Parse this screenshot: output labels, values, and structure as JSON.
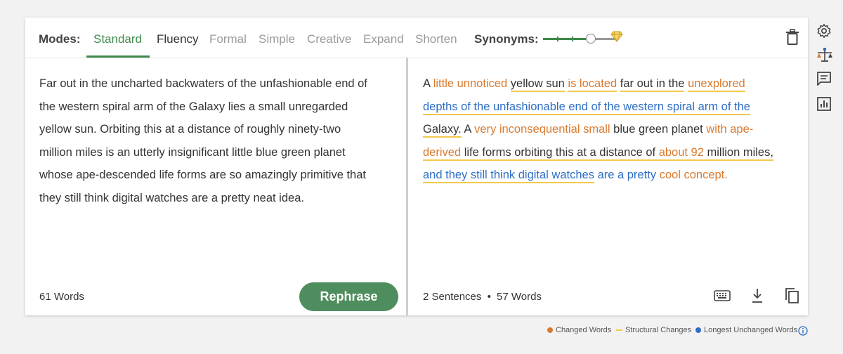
{
  "modes": {
    "label": "Modes:",
    "items": [
      "Standard",
      "Fluency",
      "Formal",
      "Simple",
      "Creative",
      "Expand",
      "Shorten"
    ],
    "active": "Standard"
  },
  "synonyms": {
    "label": "Synonyms:",
    "level": 0.6
  },
  "input": {
    "lines": [
      "Far out in the uncharted backwaters of the unfashionable end of",
      "the western spiral arm of the Galaxy lies a small unregarded",
      "yellow sun. Orbiting this at a distance of roughly ninety-two",
      "million miles is an utterly insignificant little blue green planet",
      "whose ape-descended life forms are so amazingly primitive that",
      "they still think digital watches are a pretty neat idea."
    ],
    "word_count": "61 Words",
    "rephrase_label": "Rephrase"
  },
  "output": {
    "segments": [
      {
        "t": "A ",
        "c": ""
      },
      {
        "t": "little unnoticed",
        "c": "orange"
      },
      {
        "t": " ",
        "c": ""
      },
      {
        "t": "yellow sun",
        "c": "ul"
      },
      {
        "t": " ",
        "c": ""
      },
      {
        "t": "is located",
        "c": "orange ul"
      },
      {
        "t": " ",
        "c": ""
      },
      {
        "t": "far out in the",
        "c": "ul"
      },
      {
        "t": " ",
        "c": ""
      },
      {
        "t": "unexplored",
        "c": "orange ul"
      },
      {
        "br": true
      },
      {
        "t": "depths of the unfashionable end of the western spiral arm of the",
        "c": "blue ul"
      },
      {
        "br": true
      },
      {
        "t": "Galaxy.",
        "c": "ul"
      },
      {
        "t": " A ",
        "c": ""
      },
      {
        "t": "very inconsequential small",
        "c": "orange"
      },
      {
        "t": " blue green planet ",
        "c": ""
      },
      {
        "t": "with ape-",
        "c": "orange"
      },
      {
        "br": true
      },
      {
        "t": "derived",
        "c": "orange ul"
      },
      {
        "t": " life forms orbiting this at a distance of ",
        "c": "ul"
      },
      {
        "t": "about 92",
        "c": "orange ul"
      },
      {
        "t": " million miles,",
        "c": "ul"
      },
      {
        "br": true
      },
      {
        "t": "and they still think digital watches",
        "c": "blue ul"
      },
      {
        "t": " ",
        "c": ""
      },
      {
        "t": "are a pretty",
        "c": "blue"
      },
      {
        "t": " ",
        "c": ""
      },
      {
        "t": "cool concept.",
        "c": "orange"
      }
    ],
    "sentences": "2 Sentences",
    "bullet": "•",
    "words": "57 Words"
  },
  "legend": {
    "changed": "Changed Words",
    "structural": "Structural Changes",
    "unchanged": "Longest Unchanged Words"
  },
  "colors": {
    "accent": "#3f8a4a",
    "changed": "#d97a2f",
    "structural": "#f2c94c",
    "unchanged": "#2e6ec4"
  }
}
